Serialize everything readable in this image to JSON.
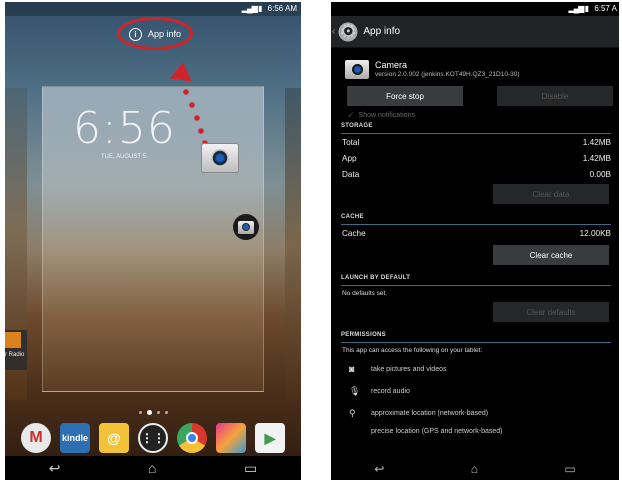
{
  "left": {
    "status_time": "6:56 AM",
    "app_info_label": "App info",
    "lock_time": "6:56",
    "lock_date": "TUE, AUGUST 5",
    "side_app_label": "r Radio",
    "dock_apps": [
      "Gmail",
      "kindle",
      "Email",
      "Apps",
      "Chrome",
      "Gallery",
      "Play Store"
    ],
    "nav_icons": [
      "back-icon",
      "home-icon",
      "recents-icon"
    ],
    "accent_color": "#d0242a"
  },
  "right": {
    "status_time": "6:57 A",
    "title": "App info",
    "app_name": "Camera",
    "version": "version 2.0.002 (jenkins.KOT49H.QZ3_21D10-30)",
    "force_stop": "Force stop",
    "disable": "Disable",
    "show_notifications": "Show notifications",
    "storage_header": "STORAGE",
    "storage": [
      {
        "label": "Total",
        "value": "1.42MB"
      },
      {
        "label": "App",
        "value": "1.42MB"
      },
      {
        "label": "Data",
        "value": "0.00B"
      }
    ],
    "clear_data": "Clear data",
    "cache_header": "CACHE",
    "cache": {
      "label": "Cache",
      "value": "12.00KB"
    },
    "clear_cache": "Clear cache",
    "launch_header": "LAUNCH BY DEFAULT",
    "no_defaults": "No defaults set.",
    "clear_defaults": "Clear defaults",
    "permissions_header": "PERMISSIONS",
    "permissions_intro": "This app can access the following on your tablet:",
    "permissions": [
      "take pictures and videos",
      "record audio",
      "approximate location (network-based)",
      "precise location (GPS and network-based)"
    ],
    "divider_color": "#3a6f86"
  }
}
